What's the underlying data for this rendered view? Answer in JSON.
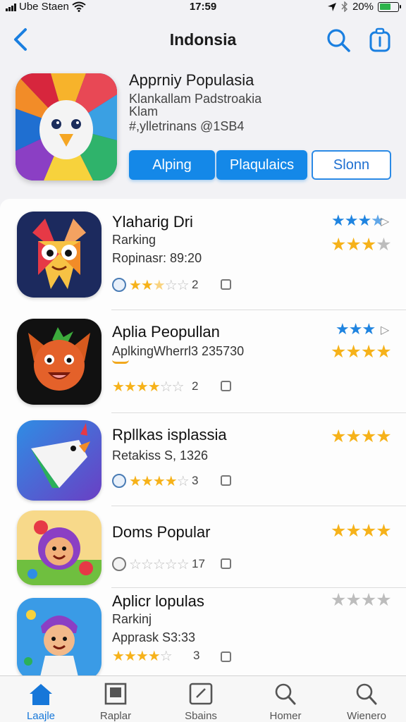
{
  "status_bar": {
    "carrier": "Ube Staen",
    "time": "17:59",
    "battery": "20%",
    "battery_level": 0.6
  },
  "nav": {
    "title": "Indonsia"
  },
  "featured": {
    "title": "Apprniy Populasia",
    "subtitle": "Klankallam Padstroakia",
    "subtitle2": "Klam",
    "tag": "#,ylletrinans @1SB4",
    "buttons": [
      "Alping",
      "Plaqulaics",
      "Slonn"
    ]
  },
  "apps": [
    {
      "name": "Ylaharig Dri",
      "line1": "Rarking",
      "line2": "Ropinasr: 89:20",
      "rating": "2",
      "header_stars": 3,
      "big_stars": 4
    },
    {
      "name": "Aplia Peopullan",
      "line1": "AplkingWherrl3 235730",
      "rating": "2",
      "header_stars": 3,
      "big_stars": 4
    },
    {
      "name": "Rpllkas isplassia",
      "line1": "Retakiss S, 1326",
      "rating": "3",
      "big_stars": 4
    },
    {
      "name": "Doms Popular",
      "rating": "17",
      "big_stars": 4
    },
    {
      "name": "Aplicr lopulas",
      "line1": "Rarkinj",
      "line2": "Apprask S3:33",
      "rating": "3",
      "big_stars": 0
    }
  ],
  "tabs": [
    "Laajle",
    "Raplar",
    "Sbains",
    "Homer",
    "Wienero"
  ],
  "colors": {
    "accent": "#1488e8",
    "star": "#f6b21a",
    "star_blue": "#1f84e0"
  }
}
